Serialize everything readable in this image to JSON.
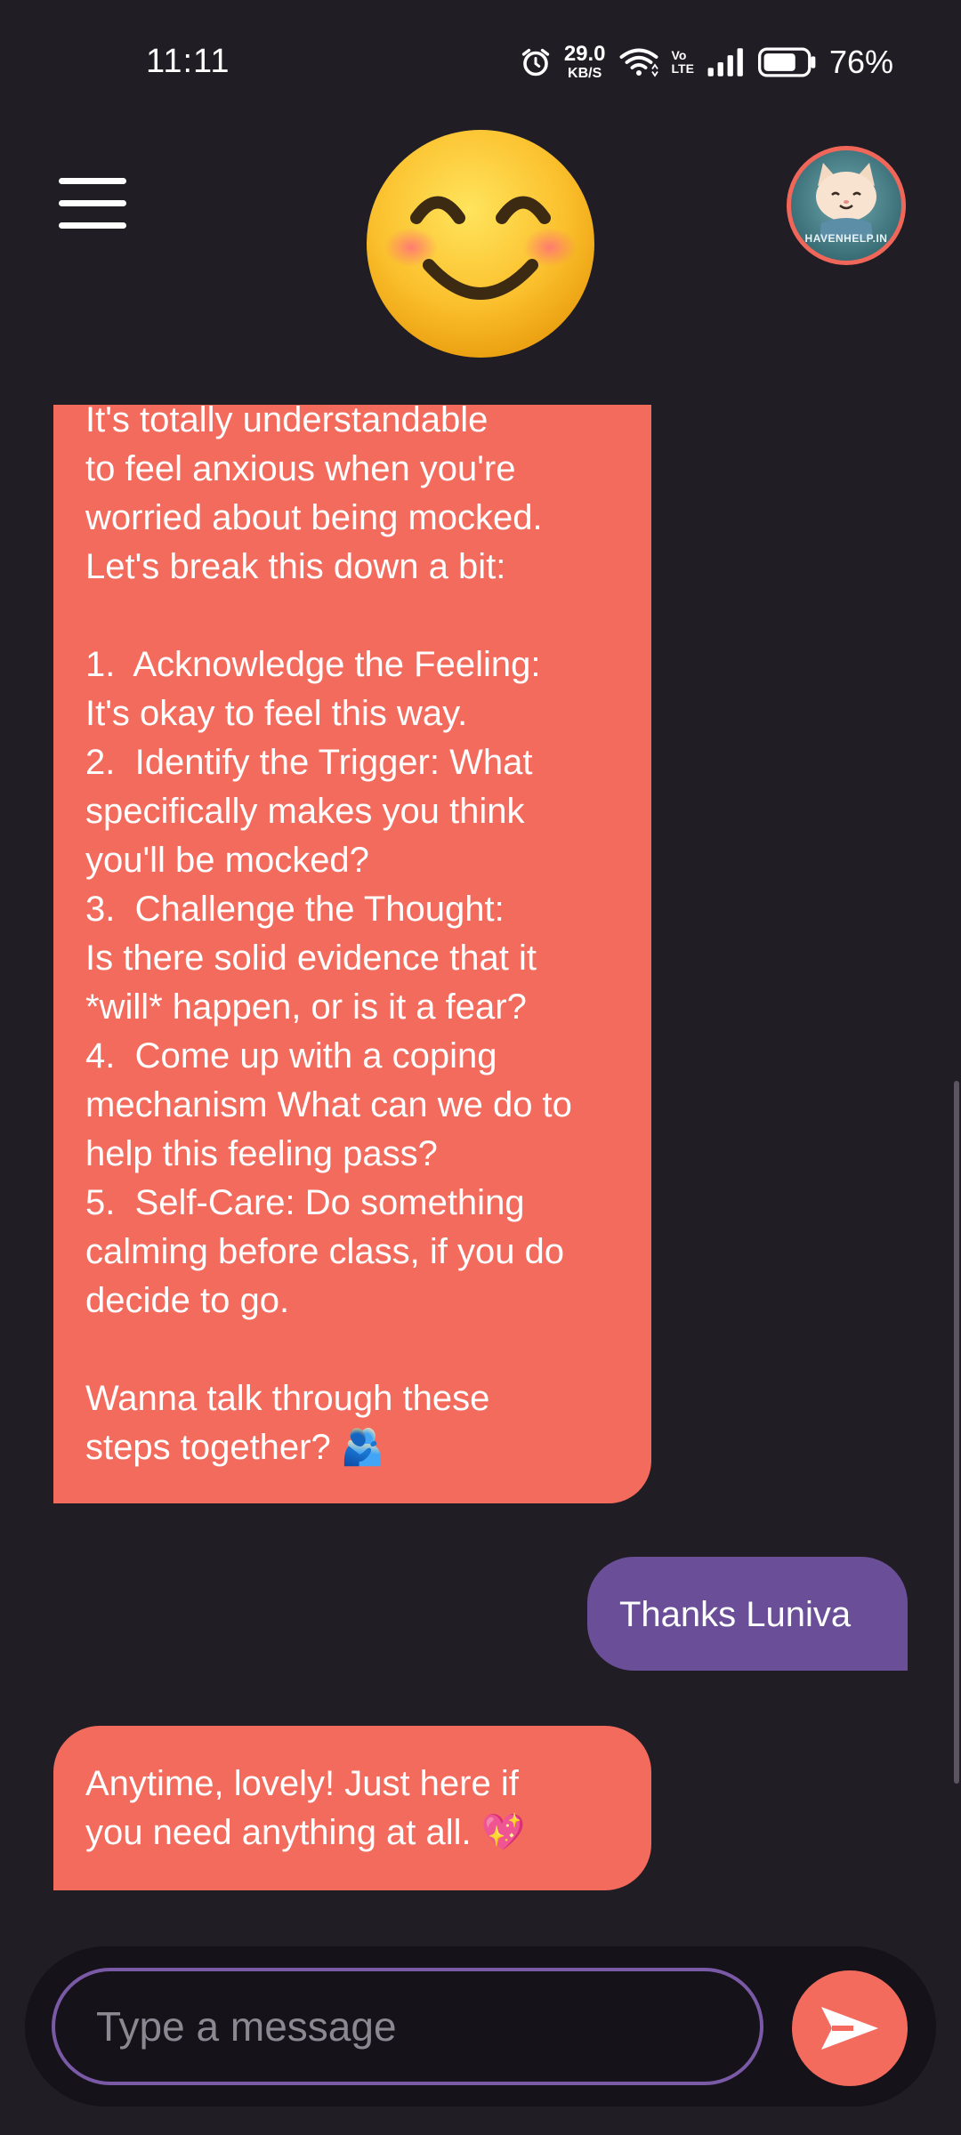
{
  "status_bar": {
    "time": "11:11",
    "net_speed_value": "29.0",
    "net_speed_unit": "KB/S",
    "volte_top": "Vo",
    "volte_bottom": "LTE",
    "battery_percent": "76%",
    "battery_level": 0.76,
    "icons": [
      "alarm-icon",
      "wifi-icon",
      "signal-icon",
      "battery-icon"
    ]
  },
  "header": {
    "menu_icon": "hamburger-menu-icon",
    "mood_emoji": "smiling-face-with-smiling-eyes",
    "avatar_text": "HAVENHELP.IN"
  },
  "messages": [
    {
      "sender": "bot",
      "text": "It's totally understandable\nto feel anxious when you're\nworried about being mocked.\nLet's break this down a bit:\n\n1.  Acknowledge the Feeling:\nIt's okay to feel this way.\n2.  Identify the Trigger: What\nspecifically makes you think\nyou'll be mocked?\n3.  Challenge the Thought:\nIs there solid evidence that it\n*will* happen, or is it a fear?\n4.  Come up with a coping\nmechanism What can we do to\nhelp this feeling pass?\n5.  Self-Care: Do something\ncalming before class, if you do\ndecide to go.\n\nWanna talk through these\nsteps together? 🫂"
    },
    {
      "sender": "user",
      "text": "Thanks Luniva"
    },
    {
      "sender": "bot",
      "text": "Anytime, lovely! Just here if\nyou need anything at all. 💖"
    }
  ],
  "composer": {
    "placeholder": "Type a message",
    "send_icon": "send-icon"
  },
  "colors": {
    "background": "#211d25",
    "bot_bubble": "#f26b5d",
    "user_bubble": "#6a4f98",
    "input_border": "#7a5aa6",
    "send_button": "#f26b5d"
  }
}
